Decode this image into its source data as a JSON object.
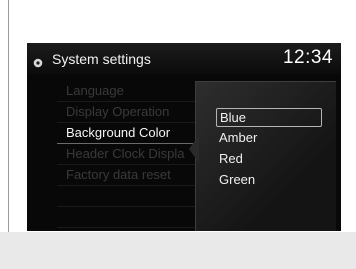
{
  "header": {
    "icon": "gear-icon",
    "title": "System settings",
    "clock": "12:34"
  },
  "menu": {
    "items": [
      {
        "label": "Language",
        "state": "dimmed"
      },
      {
        "label": "Display Operation",
        "state": "dimmed"
      },
      {
        "label": "Background Color",
        "state": "active"
      },
      {
        "label": "Header Clock Displa",
        "state": "dimmed"
      },
      {
        "label": "Factory data reset",
        "state": "dimmed"
      },
      {
        "label": "",
        "state": "empty"
      },
      {
        "label": "",
        "state": "empty"
      }
    ]
  },
  "color_popup": {
    "options": [
      {
        "label": "Blue",
        "selected": true
      },
      {
        "label": "Amber",
        "selected": false
      },
      {
        "label": "Red",
        "selected": false
      },
      {
        "label": "Green",
        "selected": false
      }
    ]
  }
}
